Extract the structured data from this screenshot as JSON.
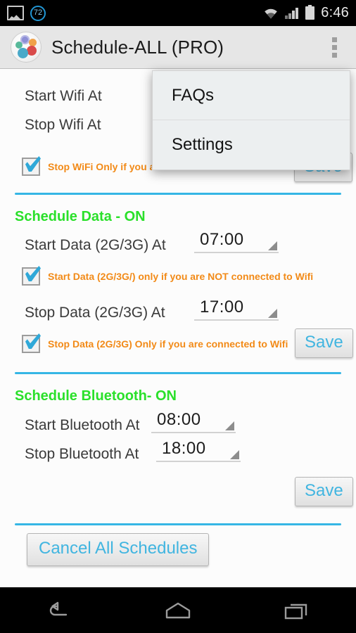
{
  "statusbar": {
    "gallery_icon": "gallery-icon",
    "badge_count": "72",
    "wifi_icon": "wifi-icon",
    "signal_icon": "signal-bars-icon",
    "battery_icon": "battery-icon",
    "time": "6:46"
  },
  "actionbar": {
    "app_icon": "gears-app-icon",
    "title": "Schedule-ALL (PRO)",
    "overflow_icon": "overflow-menu-icon"
  },
  "menu": {
    "items": [
      {
        "label": "FAQs"
      },
      {
        "label": "Settings"
      }
    ]
  },
  "wifi_section": {
    "start_label": "Start Wifi At",
    "stop_label": "Stop Wifi At",
    "stop_note": "Stop WiFi Only if you are NOT connected to Wifi",
    "save_label": "Save"
  },
  "data_section": {
    "title": "Schedule Data - ON",
    "start_label": "Start Data (2G/3G) At",
    "start_value": "07:00",
    "start_note": "Start Data (2G/3G/) only if you are NOT connected to Wifi",
    "stop_label": "Stop Data (2G/3G) At",
    "stop_value": "17:00",
    "stop_note": "Stop Data (2G/3G) Only if you are connected to Wifi",
    "save_label": "Save"
  },
  "bluetooth_section": {
    "title": "Schedule Bluetooth- ON",
    "start_label": "Start Bluetooth At",
    "start_value": "08:00",
    "stop_label": "Stop Bluetooth At",
    "stop_value": "18:00",
    "save_label": "Save"
  },
  "footer": {
    "cancel_label": "Cancel All Schedules"
  },
  "navbar": {
    "back_icon": "back-icon",
    "home_icon": "home-icon",
    "recents_icon": "recent-apps-icon"
  },
  "colors": {
    "accent_blue": "#35b6e5",
    "section_green": "#2ae02a",
    "note_orange": "#f28a17",
    "button_text": "#41b5e0"
  }
}
